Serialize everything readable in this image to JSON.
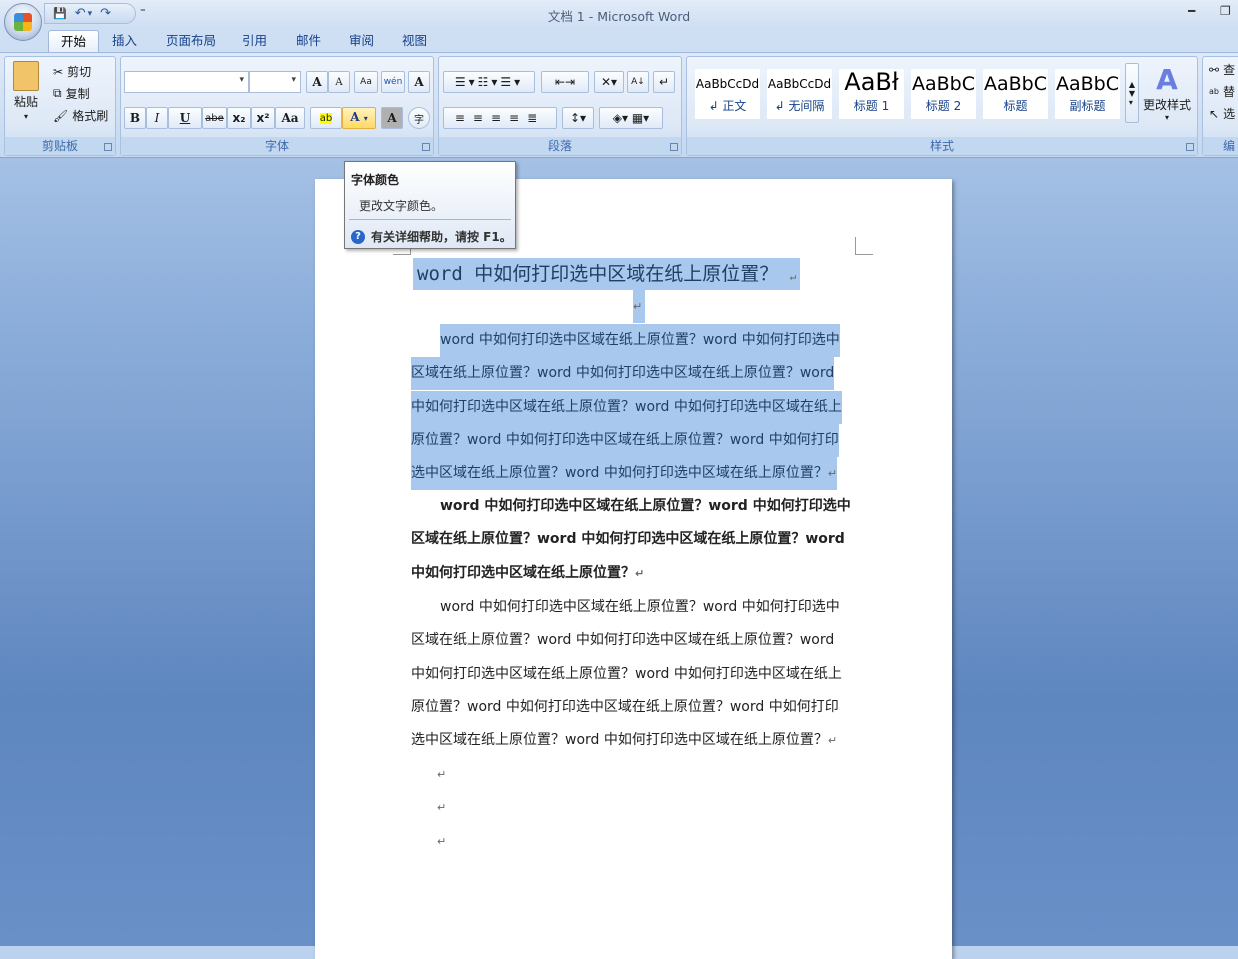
{
  "window": {
    "title": "文档 1 - Microsoft Word",
    "minimize": "━",
    "restore": "❐"
  },
  "qat": {
    "save": "💾",
    "undo": "↶",
    "undo_drop": "▾",
    "redo": "↷",
    "more": "⁼"
  },
  "tabs": [
    "开始",
    "插入",
    "页面布局",
    "引用",
    "邮件",
    "审阅",
    "视图"
  ],
  "clipboard": {
    "label": "剪贴板",
    "paste": "粘贴",
    "cut": "剪切",
    "copy": "复制",
    "format_painter": "格式刷"
  },
  "font": {
    "label": "字体",
    "font_name": "",
    "font_size": "",
    "grow": "A",
    "shrink": "A",
    "clear": "Aa",
    "pinyin": "wén",
    "border": "A",
    "bold": "B",
    "italic": "I",
    "underline": "U",
    "strike": "abe",
    "sub": "x₂",
    "sup": "x²",
    "case": "Aa",
    "highlight": "ab",
    "color": "A",
    "shade": "A",
    "enclose": "字"
  },
  "paragraph": {
    "label": "段落"
  },
  "styles": {
    "label": "样式",
    "items": [
      {
        "preview": "AaBbCcDd",
        "name": "↲ 正文"
      },
      {
        "preview": "AaBbCcDd",
        "name": "↲ 无间隔"
      },
      {
        "preview": "AaBł",
        "name": "标题 1"
      },
      {
        "preview": "AaBbC",
        "name": "标题 2"
      },
      {
        "preview": "AaBbC",
        "name": "标题"
      },
      {
        "preview": "AaBbC",
        "name": "副标题"
      }
    ],
    "change": "更改样式"
  },
  "editing": {
    "label": "编",
    "find": "查",
    "replace": "替",
    "select": "选"
  },
  "tooltip": {
    "title": "字体颜色",
    "desc": "更改文字颜色。",
    "help": "有关详细帮助，请按 F1。"
  },
  "document": {
    "title": "word 中如何打印选中区域在纸上原位置？",
    "para_mark": "↵",
    "p1": [
      "word 中如何打印选中区域在纸上原位置？word 中如何打印选中",
      "区域在纸上原位置？word 中如何打印选中区域在纸上原位置？word",
      "中如何打印选中区域在纸上原位置？word 中如何打印选中区域在纸上",
      "原位置？word 中如何打印选中区域在纸上原位置？word 中如何打印",
      "选中区域在纸上原位置？word 中如何打印选中区域在纸上原位置？"
    ],
    "p2": [
      "word 中如何打印选中区域在纸上原位置？word 中如何打印选中",
      "区域在纸上原位置？word 中如何打印选中区域在纸上原位置？word",
      "中如何打印选中区域在纸上原位置？"
    ],
    "p3": [
      "word 中如何打印选中区域在纸上原位置？word 中如何打印选中",
      "区域在纸上原位置？word 中如何打印选中区域在纸上原位置？word",
      "中如何打印选中区域在纸上原位置？word 中如何打印选中区域在纸上",
      "原位置？word 中如何打印选中区域在纸上原位置？word 中如何打印",
      "选中区域在纸上原位置？word 中如何打印选中区域在纸上原位置？"
    ]
  }
}
